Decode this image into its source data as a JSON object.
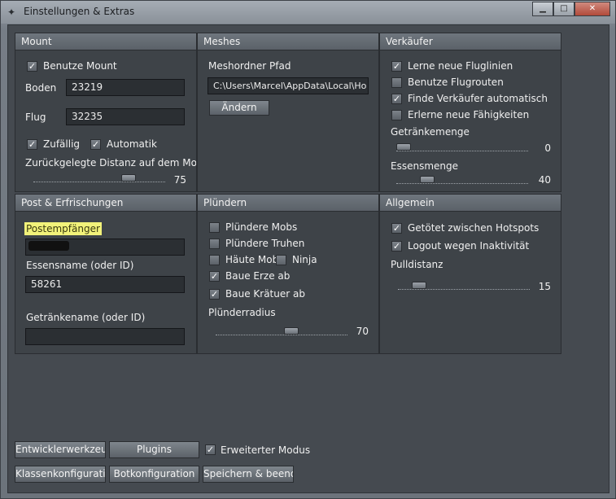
{
  "window": {
    "title": "Einstellungen & Extras",
    "controls": {
      "minimize": "▁",
      "maximize": "□",
      "close": "✕"
    }
  },
  "mount": {
    "header": "Mount",
    "use_mount_label": "Benutze Mount",
    "use_mount_checked": true,
    "boden_label": "Boden",
    "boden_value": "23219",
    "flug_label": "Flug",
    "flug_value": "32235",
    "zufaellig_label": "Zufällig",
    "zufaellig_checked": true,
    "automatik_label": "Automatik",
    "automatik_checked": true,
    "distance_label": "Zurückgelegte Distanz auf dem Mount",
    "distance_value": "75",
    "distance_level": 0.75
  },
  "meshes": {
    "header": "Meshes",
    "path_label": "Meshordner Pfad",
    "path_value": "C:\\Users\\Marcel\\AppData\\Local\\Ho",
    "change_button": "Ändern"
  },
  "vendor": {
    "header": "Verkäufer",
    "items": [
      {
        "label": "Lerne neue Fluglinien",
        "checked": true
      },
      {
        "label": "Benutze Flugrouten",
        "checked": false
      },
      {
        "label": "Finde Verkäufer automatisch",
        "checked": true
      },
      {
        "label": "Erlerne neue Fähigkeiten",
        "checked": false
      }
    ],
    "drink_label": "Getränkemenge",
    "drink_value": "0",
    "drink_level": 0.0,
    "food_label": "Essensmenge",
    "food_value": "40",
    "food_level": 0.2
  },
  "post": {
    "header": "Post & Erfrischungen",
    "recipient_label": "Postempfänger",
    "recipient_value": "",
    "food_name_label": "Essensname (oder ID)",
    "food_name_value": "58261",
    "drink_name_label": "Getränkename (oder ID)",
    "drink_name_value": ""
  },
  "loot": {
    "header": "Plündern",
    "items": [
      {
        "label": "Plündere Mobs",
        "checked": false
      },
      {
        "label": "Plündere Truhen",
        "checked": false
      },
      {
        "label": "Häute Mob",
        "checked": false
      },
      {
        "label": "Ninja",
        "checked": false
      },
      {
        "label": "Baue Erze ab",
        "checked": true
      },
      {
        "label": "Baue Krätuer ab",
        "checked": true
      }
    ],
    "radius_label": "Plünderradius",
    "radius_value": "70",
    "radius_level": 0.58
  },
  "general": {
    "header": "Allgemein",
    "items": [
      {
        "label": "Getötet zwischen Hotspots",
        "checked": true
      },
      {
        "label": "Logout wegen Inaktivität",
        "checked": true
      }
    ],
    "pull_label": "Pulldistanz",
    "pull_value": "15",
    "pull_level": 0.12
  },
  "footer": {
    "devtools": "Entwicklerwerkzeuge",
    "plugins": "Plugins",
    "extended_mode": "Erweiterter Modus",
    "extended_checked": true,
    "class_config": "Klassenkonfiguration",
    "bot_config": "Botkonfiguration",
    "save_close": "Speichern & beenden"
  }
}
